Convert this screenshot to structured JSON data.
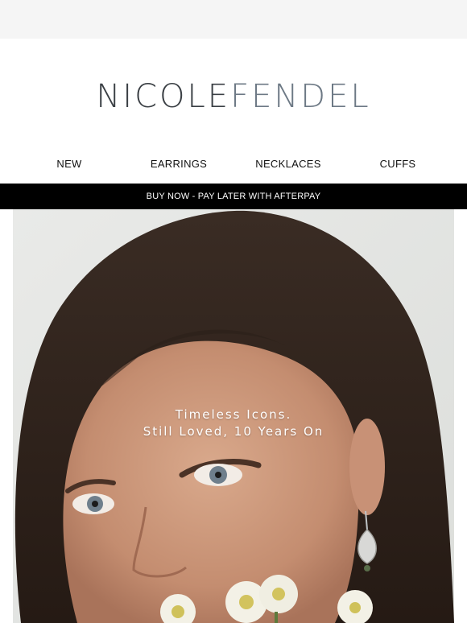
{
  "brand": {
    "logo_first": "NICOLE",
    "logo_second": "FENDEL"
  },
  "nav": {
    "items": [
      {
        "label": "NEW"
      },
      {
        "label": "EARRINGS"
      },
      {
        "label": "NECKLACES"
      },
      {
        "label": "CUFFS"
      }
    ]
  },
  "promo": {
    "label": "BUY NOW - PAY LATER WITH AFTERPAY"
  },
  "hero": {
    "line1": "Timeless Icons.",
    "line2": "Still Loved, 10 Years On"
  },
  "colors": {
    "logo_dark": "#3a3f44",
    "logo_light": "#6d7985",
    "promo_bg": "#000000",
    "top_strip": "#f5f5f5"
  }
}
